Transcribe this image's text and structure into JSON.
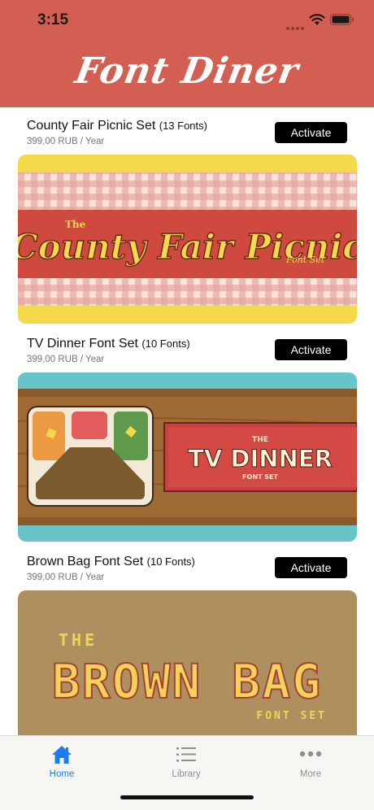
{
  "status_bar": {
    "time": "3:15"
  },
  "header": {
    "title": "Font Diner"
  },
  "items": [
    {
      "name": "County Fair Picnic Set",
      "count": "(13 Fonts)",
      "price": "399,00 RUB / Year",
      "button": "Activate",
      "banner": {
        "line1": "The",
        "main": "County Fair Picnic",
        "sub": "Font Set"
      }
    },
    {
      "name": "TV Dinner Font Set",
      "count": "(10 Fonts)",
      "price": "399,00 RUB / Year",
      "button": "Activate",
      "banner": {
        "line1": "THE",
        "main": "TV DINNER",
        "sub": "FONT SET"
      }
    },
    {
      "name": "Brown Bag Font Set",
      "count": "(10 Fonts)",
      "price": "399,00 RUB / Year",
      "button": "Activate",
      "banner": {
        "line1": "THE",
        "main": "BROWN BAG",
        "sub": "FONT SET"
      }
    }
  ],
  "tabs": [
    {
      "label": "Home",
      "icon": "home-icon",
      "active": true
    },
    {
      "label": "Library",
      "icon": "list-icon",
      "active": false
    },
    {
      "label": "More",
      "icon": "more-icon",
      "active": false
    }
  ],
  "colors": {
    "header": "#d35f52",
    "accent": "#1a7ef2",
    "button": "#000000"
  }
}
